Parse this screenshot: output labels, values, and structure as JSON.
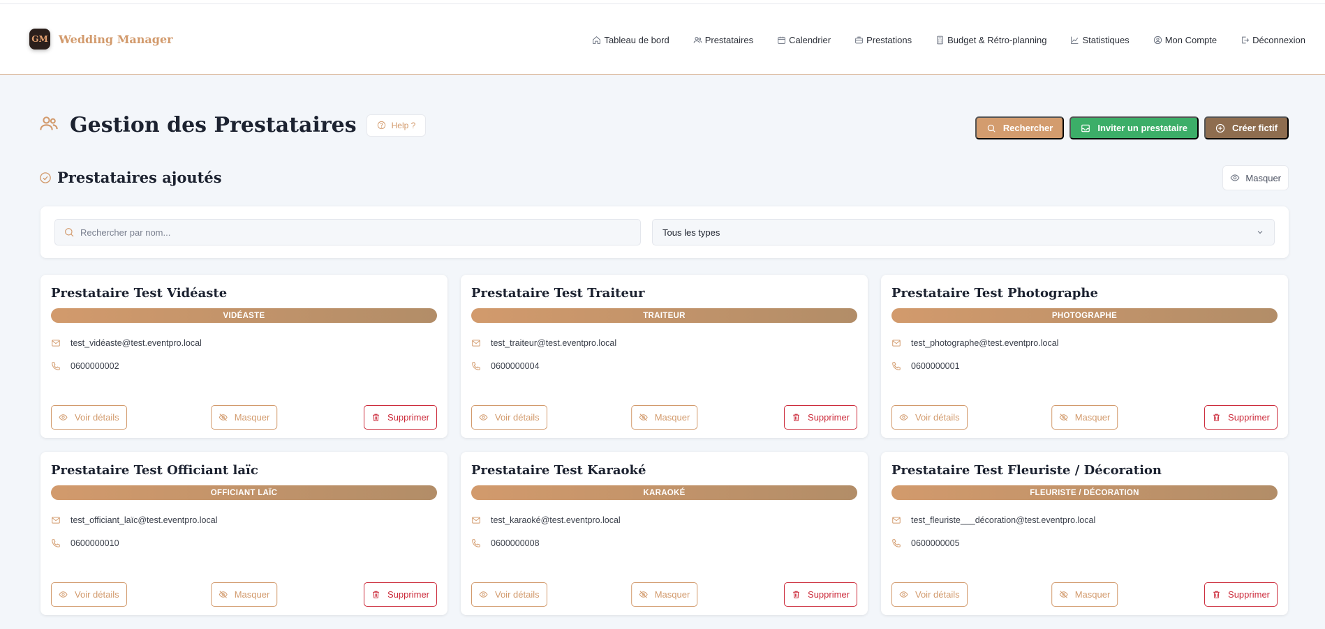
{
  "brand": {
    "logo_text": "GM",
    "name": "Wedding Manager"
  },
  "nav": [
    {
      "label": "Tableau de bord",
      "icon": "home-icon"
    },
    {
      "label": "Prestataires",
      "icon": "users-icon"
    },
    {
      "label": "Calendrier",
      "icon": "calendar-icon"
    },
    {
      "label": "Prestations",
      "icon": "briefcase-icon"
    },
    {
      "label": "Budget & Rétro-planning",
      "icon": "calculator-icon"
    },
    {
      "label": "Statistiques",
      "icon": "chart-line-icon"
    },
    {
      "label": "Mon Compte",
      "icon": "user-circle-icon"
    },
    {
      "label": "Déconnexion",
      "icon": "logout-icon"
    }
  ],
  "page": {
    "title": "Gestion des Prestataires",
    "help_label": "Help ?",
    "actions": {
      "search": "Rechercher",
      "invite": "Inviter un prestataire",
      "create": "Créer fictif"
    }
  },
  "section": {
    "title": "Prestataires ajoutés",
    "hide_label": "Masquer"
  },
  "filters": {
    "search_placeholder": "Rechercher par nom...",
    "type_selected": "Tous les types"
  },
  "card_actions": {
    "view": "Voir détails",
    "hide": "Masquer",
    "delete": "Supprimer"
  },
  "providers": [
    {
      "name": "Prestataire Test Vidéaste",
      "type": "VIDÉASTE",
      "email": "test_vidéaste@test.eventpro.local",
      "phone": "0600000002"
    },
    {
      "name": "Prestataire Test Traiteur",
      "type": "TRAITEUR",
      "email": "test_traiteur@test.eventpro.local",
      "phone": "0600000004"
    },
    {
      "name": "Prestataire Test Photographe",
      "type": "PHOTOGRAPHE",
      "email": "test_photographe@test.eventpro.local",
      "phone": "0600000001"
    },
    {
      "name": "Prestataire Test Officiant laïc",
      "type": "OFFICIANT LAÏC",
      "email": "test_officiant_laïc@test.eventpro.local",
      "phone": "0600000010"
    },
    {
      "name": "Prestataire Test Karaoké",
      "type": "KARAOKÉ",
      "email": "test_karaoké@test.eventpro.local",
      "phone": "0600000008"
    },
    {
      "name": "Prestataire Test Fleuriste / Décoration",
      "type": "FLEURISTE / DÉCORATION",
      "email": "test_fleuriste___décoration@test.eventpro.local",
      "phone": "0600000005"
    }
  ]
}
